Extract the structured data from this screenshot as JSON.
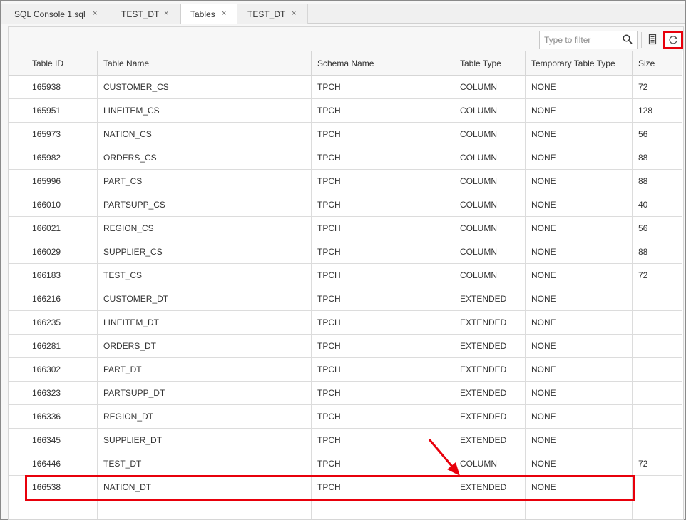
{
  "tabs": [
    {
      "label": "SQL Console 1.sql",
      "close": "×",
      "active": false
    },
    {
      "label": "TEST_DT",
      "close": "×",
      "active": false
    },
    {
      "label": "Tables",
      "close": "×",
      "active": true
    },
    {
      "label": "TEST_DT",
      "close": "×",
      "active": false
    }
  ],
  "toolbar": {
    "filter_placeholder": "Type to filter",
    "search_icon": "search-icon",
    "columns_icon": "columns-icon",
    "refresh_icon": "refresh-icon"
  },
  "table": {
    "columns": [
      "",
      "Table ID",
      "Table Name",
      "Schema Name",
      "Table Type",
      "Temporary Table Type",
      "Size"
    ],
    "rows": [
      [
        "",
        "165938",
        "CUSTOMER_CS",
        "TPCH",
        "COLUMN",
        "NONE",
        "72"
      ],
      [
        "",
        "165951",
        "LINEITEM_CS",
        "TPCH",
        "COLUMN",
        "NONE",
        "128"
      ],
      [
        "",
        "165973",
        "NATION_CS",
        "TPCH",
        "COLUMN",
        "NONE",
        "56"
      ],
      [
        "",
        "165982",
        "ORDERS_CS",
        "TPCH",
        "COLUMN",
        "NONE",
        "88"
      ],
      [
        "",
        "165996",
        "PART_CS",
        "TPCH",
        "COLUMN",
        "NONE",
        "88"
      ],
      [
        "",
        "166010",
        "PARTSUPP_CS",
        "TPCH",
        "COLUMN",
        "NONE",
        "40"
      ],
      [
        "",
        "166021",
        "REGION_CS",
        "TPCH",
        "COLUMN",
        "NONE",
        "56"
      ],
      [
        "",
        "166029",
        "SUPPLIER_CS",
        "TPCH",
        "COLUMN",
        "NONE",
        "88"
      ],
      [
        "",
        "166183",
        "TEST_CS",
        "TPCH",
        "COLUMN",
        "NONE",
        "72"
      ],
      [
        "",
        "166216",
        "CUSTOMER_DT",
        "TPCH",
        "EXTENDED",
        "NONE",
        ""
      ],
      [
        "",
        "166235",
        "LINEITEM_DT",
        "TPCH",
        "EXTENDED",
        "NONE",
        ""
      ],
      [
        "",
        "166281",
        "ORDERS_DT",
        "TPCH",
        "EXTENDED",
        "NONE",
        ""
      ],
      [
        "",
        "166302",
        "PART_DT",
        "TPCH",
        "EXTENDED",
        "NONE",
        ""
      ],
      [
        "",
        "166323",
        "PARTSUPP_DT",
        "TPCH",
        "EXTENDED",
        "NONE",
        ""
      ],
      [
        "",
        "166336",
        "REGION_DT",
        "TPCH",
        "EXTENDED",
        "NONE",
        ""
      ],
      [
        "",
        "166345",
        "SUPPLIER_DT",
        "TPCH",
        "EXTENDED",
        "NONE",
        ""
      ],
      [
        "",
        "166446",
        "TEST_DT",
        "TPCH",
        "COLUMN",
        "NONE",
        "72"
      ],
      [
        "",
        "166538",
        "NATION_DT",
        "TPCH",
        "EXTENDED",
        "NONE",
        ""
      ],
      [
        "",
        "",
        "",
        "",
        "",
        "",
        ""
      ]
    ]
  },
  "colors": {
    "highlight": "#e8000b",
    "border": "#d6d6d6"
  }
}
